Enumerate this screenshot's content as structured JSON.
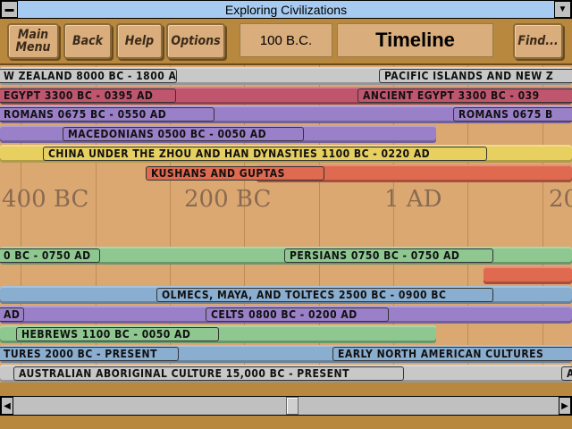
{
  "window": {
    "title": "Exploring Civilizations"
  },
  "toolbar": {
    "main_menu": "Main Menu",
    "back": "Back",
    "help": "Help",
    "options": "Options",
    "current_date": "100 B.C.",
    "section_title": "Timeline",
    "find": "Find..."
  },
  "axis": {
    "labels": [
      "400 BC",
      "200 BC",
      "1 AD",
      "20"
    ]
  },
  "bars": [
    {
      "color": "#c8c8c8",
      "labels": [
        "W ZEALAND   8000 BC - 1800 AD",
        "PACIFIC ISLANDS AND NEW Z"
      ]
    },
    {
      "color": "#c0566e",
      "labels": [
        "EGYPT   3300 BC - 0395 AD",
        "ANCIENT EGYPT   3300 BC - 039"
      ]
    },
    {
      "color": "#9a80c8",
      "labels": [
        "ROMANS   0675 BC - 0550 AD",
        "ROMANS   0675 B"
      ]
    },
    {
      "color": "#9a80c8",
      "labels": [
        "MACEDONIANS   0500 BC - 0050 AD"
      ]
    },
    {
      "color": "#e8d060",
      "labels": [
        "CHINA UNDER THE ZHOU AND HAN DYNASTIES   1100 BC - 0220 AD"
      ]
    },
    {
      "color": "#e06a50",
      "labels": [
        "KUSHANS AND GUPTAS"
      ]
    },
    {
      "color": "#8ec890",
      "labels": [
        "0 BC - 0750 AD",
        "PERSIANS   0750 BC - 0750 AD"
      ]
    },
    {
      "color": "#e06a50",
      "labels": []
    },
    {
      "color": "#8aaed0",
      "labels": [
        "OLMECS, MAYA, AND TOLTECS   2500 BC - 0900 BC"
      ]
    },
    {
      "color": "#9a80c8",
      "labels": [
        "AD",
        "CELTS   0800 BC - 0200 AD"
      ]
    },
    {
      "color": "#8ec890",
      "labels": [
        "HEBREWS   1100 BC - 0050 AD"
      ]
    },
    {
      "color": "#8aaed0",
      "labels": [
        "TURES   2000 BC - PRESENT",
        "EARLY NORTH AMERICAN CULTURES"
      ]
    },
    {
      "color": "#c8c8c8",
      "labels": [
        "AUSTRALIAN ABORIGINAL CULTURE   15,000 BC - PRESENT",
        "A"
      ]
    }
  ]
}
